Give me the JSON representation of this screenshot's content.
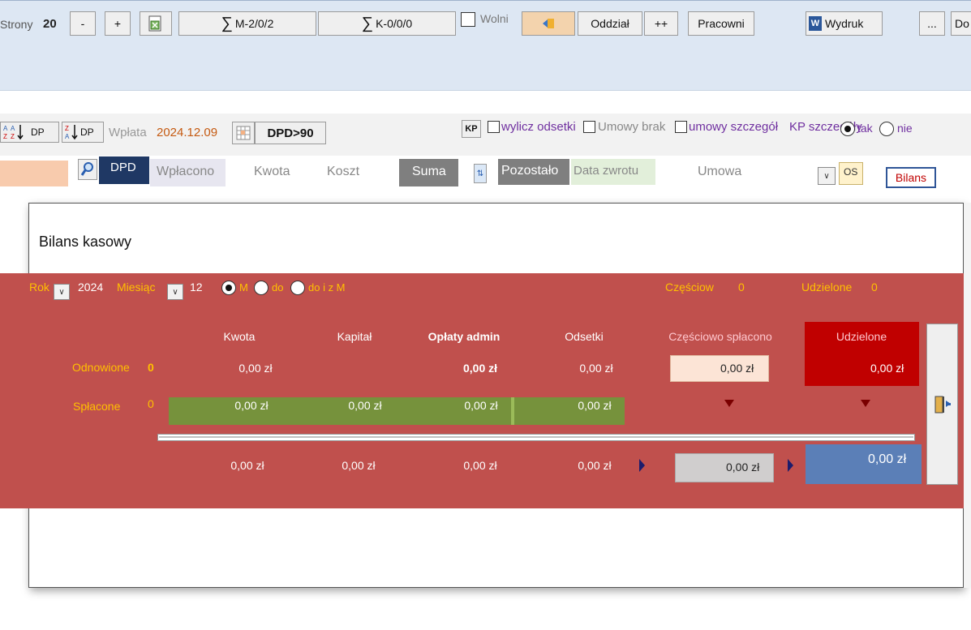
{
  "toolbar": {
    "strony_label": "Strony",
    "strony_value": "20",
    "minus": "-",
    "plus": "+",
    "sum_m": "M-2/0/2",
    "sum_k": "K-0/0/0",
    "sigma": "∑",
    "wolni": "Wolni",
    "oddzial": "Oddział",
    "plusplus": "++",
    "pracowni": "Pracowni",
    "word_letter": "W",
    "wydruk": "Wydruk",
    "ellipsis": "...",
    "do": "Do"
  },
  "filter_bar": {
    "dp1": "DP",
    "dp2": "DP",
    "wplata_label": "Wpłata",
    "wplata_date": "2024.12.09",
    "dpd90": "DPD>90",
    "kp_button": "KP",
    "wylicz_odsetki": "wylicz odsetki",
    "umowy_brak": "Umowy brak",
    "umowy_szczegol": "umowy szczegół",
    "kp_szczegoly": "KP szczegóły",
    "tak": "tak",
    "nie": "nie"
  },
  "columns": {
    "dpd": "DPD",
    "wplacono": "Wpłacono",
    "kwota": "Kwota",
    "koszt": "Koszt",
    "suma": "Suma",
    "pozostalo": "Pozostało",
    "data_zwrotu": "Data zwrotu",
    "umowa": "Umowa",
    "os": "OS",
    "bilans": "Bilans"
  },
  "dialog": {
    "title": "Bilans kasowy",
    "rok_label": "Rok",
    "rok_value": "2024",
    "miesiac_label": "Miesiąc",
    "miesiac_value": "12",
    "radio_m": "M",
    "radio_do": "do",
    "radio_doizm": "do i z M",
    "czesciow_label": "Częściow",
    "czesciow_value": "0",
    "udzielone_label": "Udzielone",
    "udzielone_value": "0",
    "headers": {
      "kwota": "Kwota",
      "kapital": "Kapitał",
      "oplaty": "Opłaty admin",
      "odsetki": "Odsetki",
      "czesciowo": "Częściowo spłacono",
      "udzielone": "Udzielone"
    },
    "odnowione": {
      "label": "Odnowione",
      "count": "0",
      "kwota": "0,00 zł",
      "oplaty": "0,00 zł",
      "odsetki": "0,00 zł",
      "czesciowo": "0,00 zł",
      "udzielone": "0,00 zł"
    },
    "splacone": {
      "label": "Spłacone",
      "count": "0",
      "kwota": "0,00 zł",
      "kapital": "0,00 zł",
      "oplaty": "0,00 zł",
      "odsetki": "0,00 zł"
    },
    "totals": {
      "kwota": "0,00 zł",
      "kapital": "0,00 zł",
      "oplaty": "0,00 zł",
      "odsetki": "0,00 zł",
      "czesciowo": "0,00 zł",
      "udzielone": "0,00 zł"
    }
  },
  "colors": {
    "accent_red": "#c0504d",
    "dark_red": "#c00000",
    "olive_green": "#76923c",
    "dark_blue": "#1f3864",
    "steel_blue": "#5b7fb7",
    "orange_text": "#c55a11"
  },
  "icons": [
    "sort-icon",
    "excel-export-icon",
    "grid-icon",
    "exit-icon",
    "search-icon",
    "word-icon",
    "door-exit-icon"
  ]
}
